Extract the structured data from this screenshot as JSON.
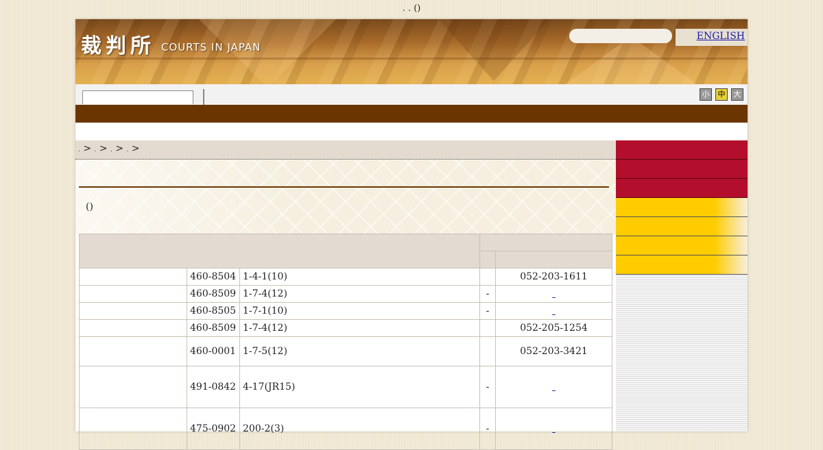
{
  "top_note": {
    "dots": ". .",
    "paren": "()"
  },
  "header": {
    "logo_kanji": "裁判所",
    "logo_en": "COURTS IN JAPAN",
    "english_link": "ENGLISH"
  },
  "toolbar": {
    "font_size_small": "小",
    "font_size_medium": "中",
    "font_size_large": "大"
  },
  "breadcrumb": {
    "sep": ">"
  },
  "content": {
    "lead": "()"
  },
  "table": {
    "rows": [
      {
        "name": "",
        "postal": "460-8504",
        "address": "1-4-1(10)",
        "mark": "",
        "phone": "052-203-1611",
        "phone_is_link": false
      },
      {
        "name": "",
        "postal": "460-8509",
        "address": "1-7-4(12)",
        "mark": "-",
        "phone": "",
        "phone_is_link": true
      },
      {
        "name": "",
        "postal": "460-8505",
        "address": "1-7-1(10)",
        "mark": "-",
        "phone": "",
        "phone_is_link": true
      },
      {
        "name": "",
        "postal": "460-8509",
        "address": "1-7-4(12)",
        "mark": "",
        "phone": "052-205-1254",
        "phone_is_link": false
      },
      {
        "name": "",
        "postal": "460-0001",
        "address": "1-7-5(12)",
        "mark": "",
        "phone": "052-203-3421",
        "phone_is_link": false
      },
      {
        "name": "",
        "postal": "491-0842",
        "address": "4-17(JR15)",
        "mark": "-",
        "phone": "",
        "phone_is_link": true
      },
      {
        "name": "",
        "postal": "475-0902",
        "address": "200-2(3)",
        "mark": "-",
        "phone": "",
        "phone_is_link": true
      }
    ]
  },
  "colors": {
    "nav_brown": "#6a3500",
    "sidebar_red": "#b30f2c",
    "sidebar_yellow": "#ffcc00",
    "link": "#1a1aa6"
  }
}
